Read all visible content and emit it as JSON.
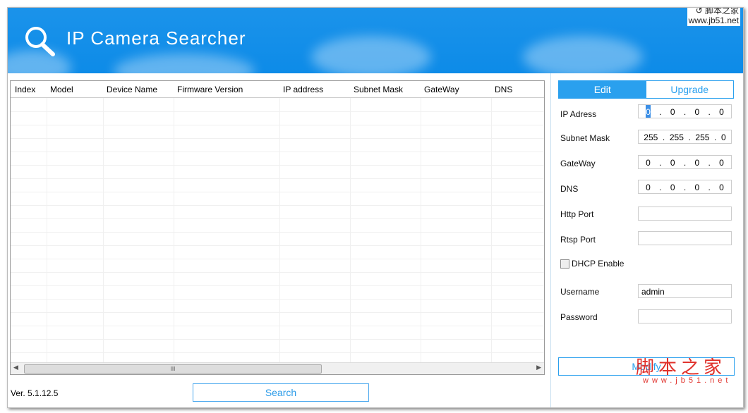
{
  "header": {
    "title": "IP Camera Searcher",
    "watermark_top": "脚本之家",
    "watermark_url": "www.jb51.net"
  },
  "table": {
    "columns": [
      "Index",
      "Model",
      "Device Name",
      "Firmware Version",
      "IP address",
      "Subnet Mask",
      "GateWay",
      "DNS"
    ],
    "rows": []
  },
  "footer": {
    "version": "Ver. 5.1.12.5",
    "search_label": "Search"
  },
  "panel": {
    "tabs": [
      "Edit",
      "Upgrade"
    ],
    "active_tab": "Edit",
    "ip_label": "IP Adress",
    "ip": [
      "0",
      "0",
      "0",
      "0"
    ],
    "mask_label": "Subnet Mask",
    "mask": [
      "255",
      "255",
      "255",
      "0"
    ],
    "gw_label": "GateWay",
    "gw": [
      "0",
      "0",
      "0",
      "0"
    ],
    "dns_label": "DNS",
    "dns": [
      "0",
      "0",
      "0",
      "0"
    ],
    "http_label": "Http Port",
    "http": "",
    "rtsp_label": "Rtsp Port",
    "rtsp": "",
    "dhcp_label": "DHCP Enable",
    "dhcp": false,
    "user_label": "Username",
    "user": "admin",
    "pass_label": "Password",
    "pass": "",
    "modify_label": "Modify"
  },
  "watermark": {
    "text": "脚本之家",
    "url": "www.jb51.net"
  }
}
